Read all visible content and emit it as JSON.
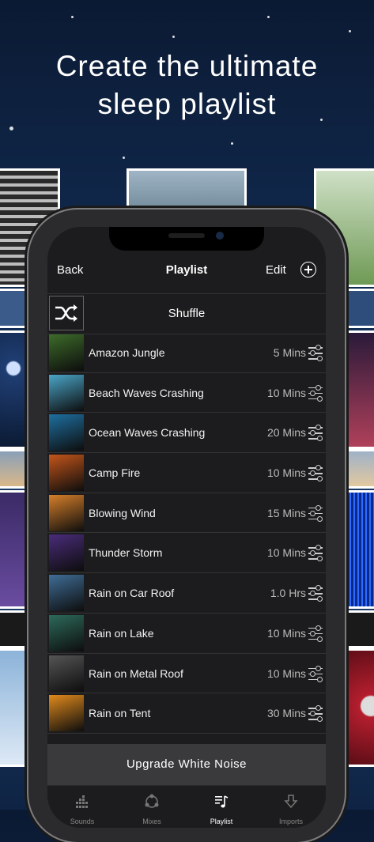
{
  "headline": {
    "line1": "Create the ultimate",
    "line2": "sleep playlist"
  },
  "nav": {
    "back": "Back",
    "title": "Playlist",
    "edit": "Edit"
  },
  "shuffle": {
    "label": "Shuffle"
  },
  "items": [
    {
      "name": "Amazon Jungle",
      "duration": "5 Mins",
      "thumb_color": "#3d6b2a"
    },
    {
      "name": "Beach Waves Crashing",
      "duration": "10 Mins",
      "thumb_color": "#4aa5c8"
    },
    {
      "name": "Ocean Waves Crashing",
      "duration": "20 Mins",
      "thumb_color": "#1e6fa0"
    },
    {
      "name": "Camp Fire",
      "duration": "10 Mins",
      "thumb_color": "#c4551a"
    },
    {
      "name": "Blowing Wind",
      "duration": "15 Mins",
      "thumb_color": "#d67f2a"
    },
    {
      "name": "Thunder Storm",
      "duration": "10 Mins",
      "thumb_color": "#4a2c7a"
    },
    {
      "name": "Rain on Car Roof",
      "duration": "1.0 Hrs",
      "thumb_color": "#3f6d96"
    },
    {
      "name": "Rain on Lake",
      "duration": "10 Mins",
      "thumb_color": "#2d6a5a"
    },
    {
      "name": "Rain on Metal Roof",
      "duration": "10 Mins",
      "thumb_color": "#555555"
    },
    {
      "name": "Rain on Tent",
      "duration": "30 Mins",
      "thumb_color": "#e08a1c"
    }
  ],
  "upgrade": {
    "label": "Upgrade White Noise"
  },
  "tabs": [
    {
      "label": "Sounds",
      "icon": "equalizer-icon"
    },
    {
      "label": "Mixes",
      "icon": "mix-icon"
    },
    {
      "label": "Playlist",
      "icon": "music-note-icon",
      "active": true
    },
    {
      "label": "Imports",
      "icon": "download-icon"
    }
  ]
}
